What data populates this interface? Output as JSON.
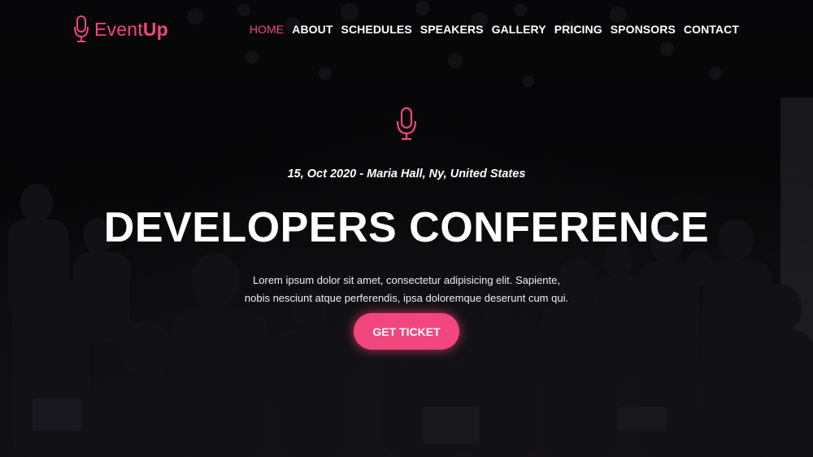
{
  "brand": {
    "name_light": "Event",
    "name_bold": "Up",
    "logo_icon": "microphone-icon",
    "accent_color": "#f2467e"
  },
  "nav": {
    "items": [
      {
        "label": "HOME",
        "active": true
      },
      {
        "label": "ABOUT",
        "active": false
      },
      {
        "label": "SCHEDULES",
        "active": false
      },
      {
        "label": "SPEAKERS",
        "active": false
      },
      {
        "label": "GALLERY",
        "active": false
      },
      {
        "label": "PRICING",
        "active": false
      },
      {
        "label": "SPONSORS",
        "active": false
      },
      {
        "label": "CONTACT",
        "active": false
      }
    ]
  },
  "hero": {
    "icon": "microphone-icon",
    "date_location": "15, Oct 2020 - Maria Hall, Ny, United States",
    "title": "DEVELOPERS CONFERENCE",
    "description": "Lorem ipsum dolor sit amet, consectetur adipisicing elit. Sapiente, nobis nesciunt atque perferendis, ipsa doloremque deserunt cum qui.",
    "cta_label": "GET TICKET"
  }
}
